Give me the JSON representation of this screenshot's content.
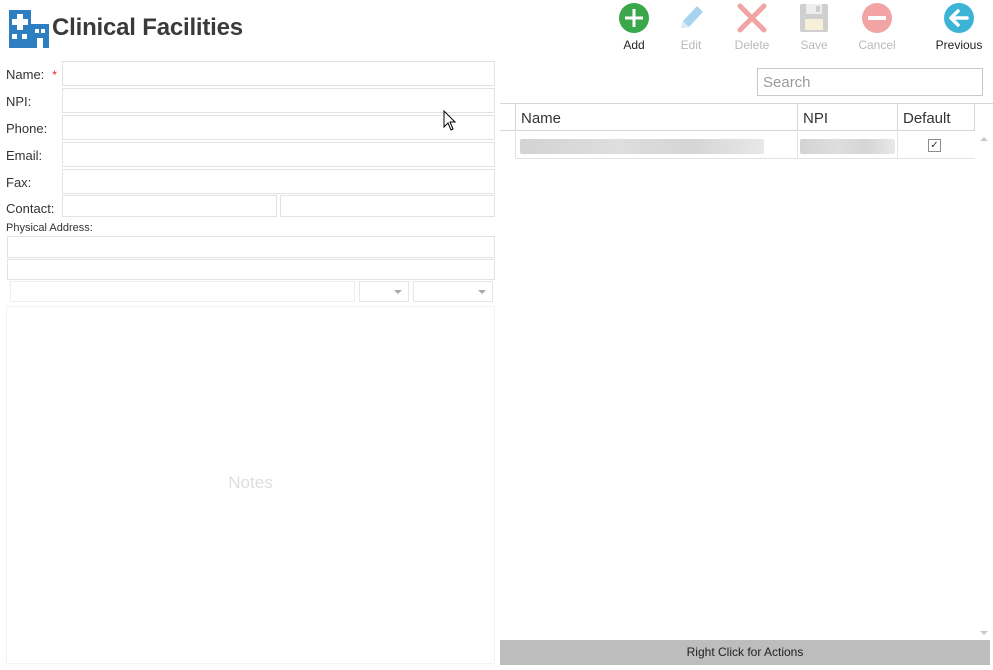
{
  "header": {
    "title": "Clinical Facilities",
    "logo_icon": "hospital-building-icon"
  },
  "toolbar": {
    "add_label": "Add",
    "edit_label": "Edit",
    "delete_label": "Delete",
    "save_label": "Save",
    "cancel_label": "Cancel",
    "previous_label": "Previous",
    "colors": {
      "add": "#3aa84a",
      "edit": "#a7d3ef",
      "delete": "#f2a3a3",
      "save": "#cfcfcf",
      "cancel": "#f2a3a3",
      "previous": "#3cb4d6"
    }
  },
  "form": {
    "name_label": "Name:",
    "required_marker": "*",
    "npi_label": "NPI:",
    "phone_label": "Phone:",
    "email_label": "Email:",
    "fax_label": "Fax:",
    "contact_label": "Contact:",
    "physical_address_label": "Physical Address:",
    "notes_placeholder": "Notes",
    "values": {
      "name": "",
      "npi": "",
      "phone": "",
      "email": "",
      "fax": "",
      "contact_first": "",
      "contact_last": "",
      "address_line1": "",
      "address_line2": "",
      "city": "",
      "state": "",
      "zip": ""
    }
  },
  "grid": {
    "search_placeholder": "Search",
    "columns": [
      "Name",
      "NPI",
      "Default"
    ],
    "rows": [
      {
        "name": "",
        "npi": "",
        "default": "✓"
      }
    ]
  },
  "status_bar": {
    "text": "Right Click for Actions"
  }
}
